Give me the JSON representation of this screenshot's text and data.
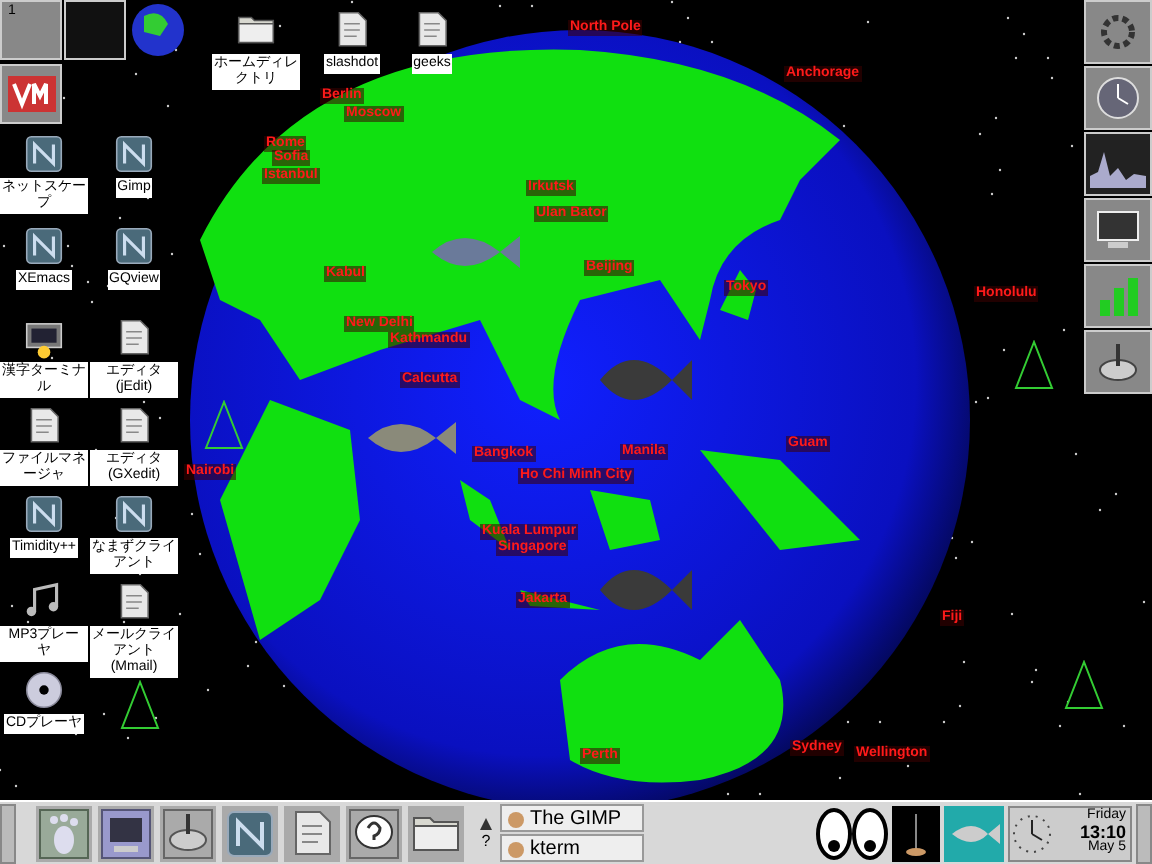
{
  "pager": {
    "desk_number": "1"
  },
  "top_icons": [
    {
      "label": "ホームディレクトリ",
      "kind": "folder"
    },
    {
      "label": "slashdot",
      "kind": "document"
    },
    {
      "label": "geeks",
      "kind": "document"
    }
  ],
  "icons": [
    {
      "label": "ネットスケープ",
      "kind": "app"
    },
    {
      "label": "Gimp",
      "kind": "app"
    },
    {
      "label": "XEmacs",
      "kind": "app"
    },
    {
      "label": "GQview",
      "kind": "app"
    },
    {
      "label": "漢字ターミナル",
      "kind": "terminal"
    },
    {
      "label": "エディタ(jEdit)",
      "kind": "document"
    },
    {
      "label": "ファイルマネージャ",
      "kind": "document"
    },
    {
      "label": "エディタ(GXedit)",
      "kind": "document"
    },
    {
      "label": "Timidity++",
      "kind": "app"
    },
    {
      "label": "なまずクライアント",
      "kind": "app"
    },
    {
      "label": "MP3プレーヤ",
      "kind": "music"
    },
    {
      "label": "メールクライアント(Mmail)",
      "kind": "document"
    },
    {
      "label": "CDプレーヤ",
      "kind": "disc"
    }
  ],
  "globe": {
    "cities": [
      {
        "name": "North Pole"
      },
      {
        "name": "Anchorage"
      },
      {
        "name": "Berlin"
      },
      {
        "name": "Moscow"
      },
      {
        "name": "Rome"
      },
      {
        "name": "Sofia"
      },
      {
        "name": "Istanbul"
      },
      {
        "name": "Kabul"
      },
      {
        "name": "New Delhi"
      },
      {
        "name": "Kathmandu"
      },
      {
        "name": "Calcutta"
      },
      {
        "name": "Irkutsk"
      },
      {
        "name": "Ulan Bator"
      },
      {
        "name": "Beijing"
      },
      {
        "name": "Tokyo"
      },
      {
        "name": "Honolulu"
      },
      {
        "name": "Bangkok"
      },
      {
        "name": "Ho Chi Minh City"
      },
      {
        "name": "Manila"
      },
      {
        "name": "Guam"
      },
      {
        "name": "Kuala Lumpur"
      },
      {
        "name": "Singapore"
      },
      {
        "name": "Jakarta"
      },
      {
        "name": "Fiji"
      },
      {
        "name": "Perth"
      },
      {
        "name": "Sydney"
      },
      {
        "name": "Wellington"
      },
      {
        "name": "Nairobi"
      }
    ]
  },
  "taskbar": {
    "launchers": [
      {
        "kind": "foot"
      },
      {
        "kind": "monitor"
      },
      {
        "kind": "tools"
      },
      {
        "kind": "app"
      },
      {
        "kind": "document"
      },
      {
        "kind": "help"
      },
      {
        "kind": "folder"
      }
    ],
    "scroll_label": "?",
    "tasks": [
      {
        "label": "The GIMP",
        "selected": false
      },
      {
        "label": "kterm",
        "selected": false
      }
    ],
    "clock": {
      "day": "Friday",
      "time": "13:10",
      "date": "May 5"
    }
  }
}
